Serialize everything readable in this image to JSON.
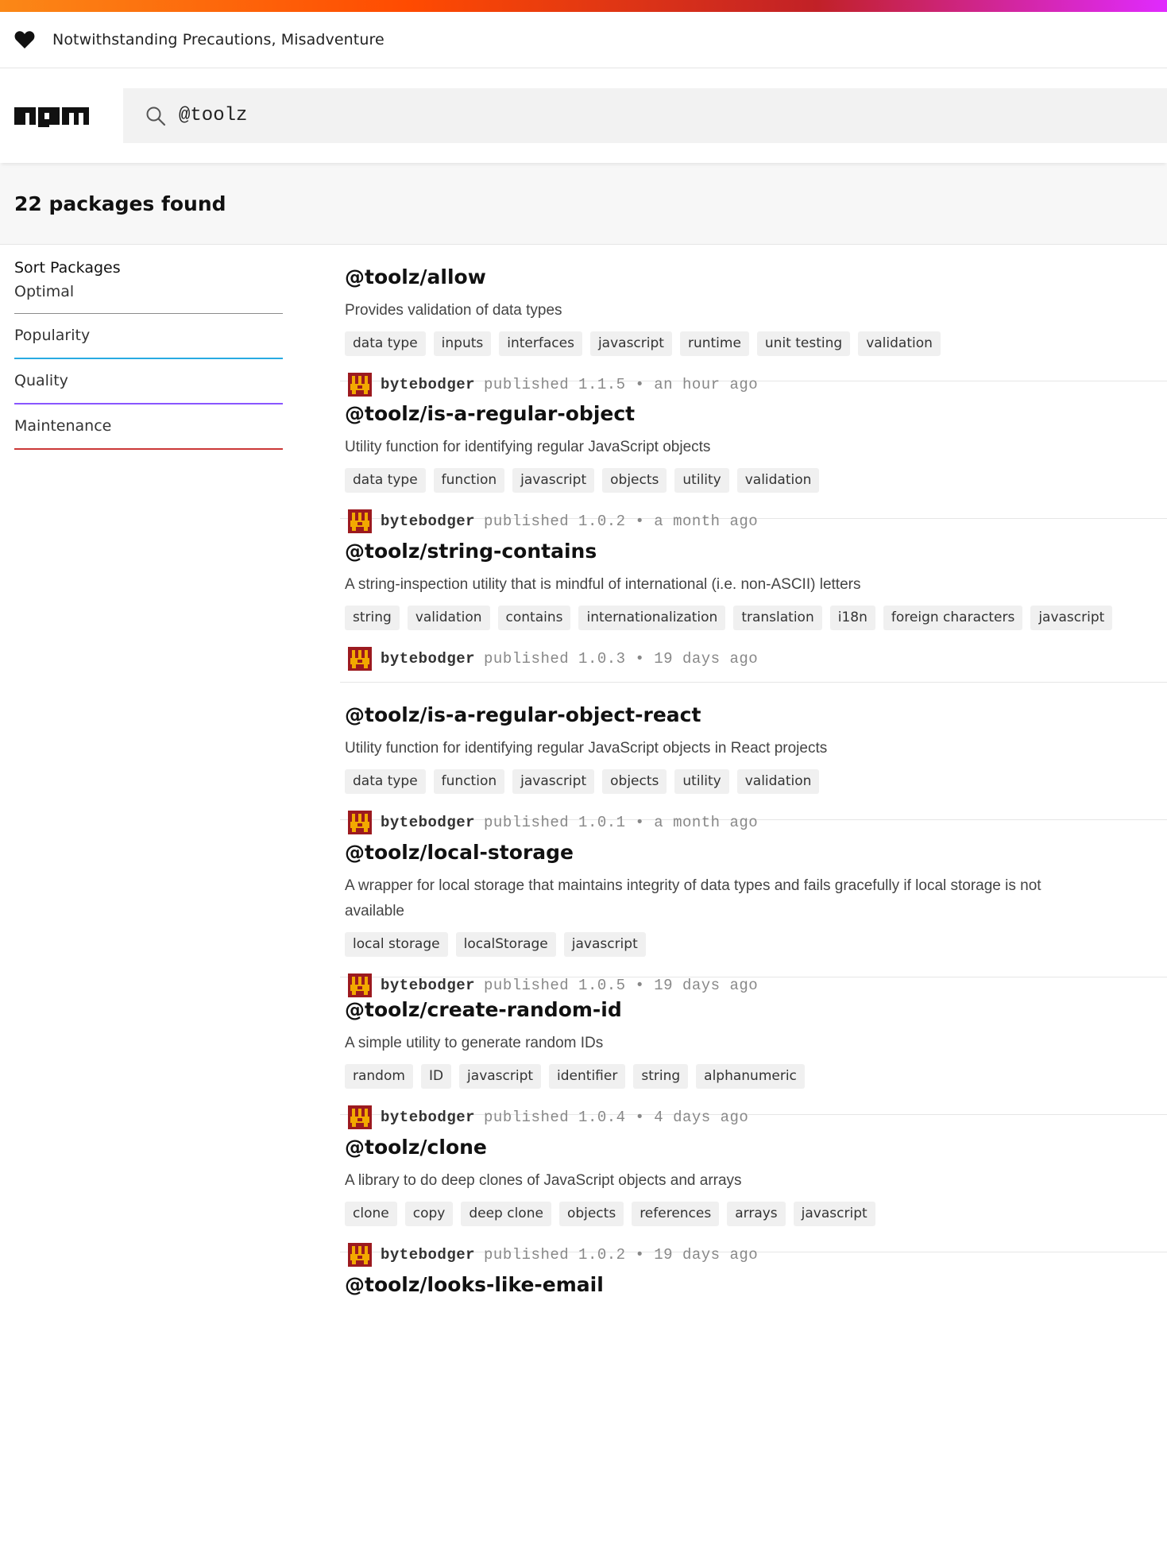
{
  "banner": {
    "text": "Notwithstanding Precautions, Misadventure"
  },
  "search": {
    "value": "@toolz"
  },
  "results": {
    "count_label": "22 packages found"
  },
  "sidebar": {
    "heading": "Sort Packages",
    "items": [
      "Optimal",
      "Popularity",
      "Quality",
      "Maintenance"
    ]
  },
  "packages": [
    {
      "name": "@toolz/allow",
      "description": "Provides validation of data types",
      "tags": [
        "data type",
        "inputs",
        "interfaces",
        "javascript",
        "runtime",
        "unit testing",
        "validation"
      ],
      "author": "bytebodger",
      "published": "published 1.1.5 • an hour ago"
    },
    {
      "name": "@toolz/is-a-regular-object",
      "description": "Utility function for identifying regular JavaScript objects",
      "tags": [
        "data type",
        "function",
        "javascript",
        "objects",
        "utility",
        "validation"
      ],
      "author": "bytebodger",
      "published": "published 1.0.2 • a month ago"
    },
    {
      "name": "@toolz/string-contains",
      "description": "A string-inspection utility that is mindful of international (i.e. non-ASCII) letters",
      "tags": [
        "string",
        "validation",
        "contains",
        "internationalization",
        "translation",
        "i18n",
        "foreign characters",
        "javascript"
      ],
      "author": "bytebodger",
      "published": "published 1.0.3 • 19 days ago"
    },
    {
      "name": "@toolz/is-a-regular-object-react",
      "description": "Utility function for identifying regular JavaScript objects in React projects",
      "tags": [
        "data type",
        "function",
        "javascript",
        "objects",
        "utility",
        "validation"
      ],
      "author": "bytebodger",
      "published": "published 1.0.1 • a month ago"
    },
    {
      "name": "@toolz/local-storage",
      "description": "A wrapper for local storage that maintains integrity of data types and fails gracefully if local storage is not available",
      "tags": [
        "local storage",
        "localStorage",
        "javascript"
      ],
      "author": "bytebodger",
      "published": "published 1.0.5 • 19 days ago"
    },
    {
      "name": "@toolz/create-random-id",
      "description": "A simple utility to generate random IDs",
      "tags": [
        "random",
        "ID",
        "javascript",
        "identifier",
        "string",
        "alphanumeric"
      ],
      "author": "bytebodger",
      "published": "published 1.0.4 • 4 days ago"
    },
    {
      "name": "@toolz/clone",
      "description": "A library to do deep clones of JavaScript objects and arrays",
      "tags": [
        "clone",
        "copy",
        "deep clone",
        "objects",
        "references",
        "arrays",
        "javascript"
      ],
      "author": "bytebodger",
      "published": "published 1.0.2 • 19 days ago"
    },
    {
      "name": "@toolz/looks-like-email",
      "description": "",
      "tags": [],
      "author": "",
      "published": ""
    }
  ],
  "colors": {
    "npm_red": "#cb3837",
    "popularity": "#29abe2",
    "quality": "#8956ff",
    "maintenance": "#cb3837"
  },
  "icons": {
    "banner": "heart-icon",
    "search": "search-icon",
    "avatar": "avatar"
  }
}
